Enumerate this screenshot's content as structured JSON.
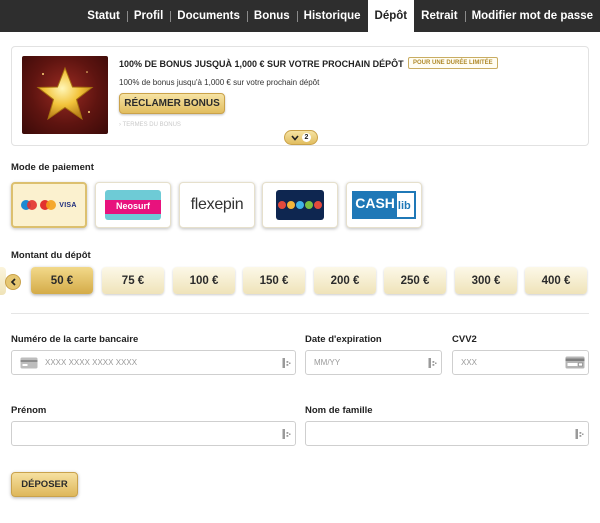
{
  "nav": {
    "items": [
      {
        "label": "Statut"
      },
      {
        "label": "Profil"
      },
      {
        "label": "Documents"
      },
      {
        "label": "Bonus"
      },
      {
        "label": "Historique"
      },
      {
        "label": "Dépôt",
        "active": true
      },
      {
        "label": "Retrait"
      },
      {
        "label": "Modifier mot de passe"
      }
    ]
  },
  "bonus": {
    "title": "100% DE BONUS JUSQUÀ 1,000 € SUR VOTRE PROCHAIN DÉPÔT",
    "badge": "POUR UNE DURÉE LIMITÉE",
    "subtitle": "100% de bonus jusqu'à 1,000 € sur votre prochain dépôt",
    "claim_label": "RÉCLAMER BONUS",
    "terms_label": "TERMES DU BONUS",
    "more_count": "2",
    "image_icon": "gold-star"
  },
  "payment": {
    "label": "Mode de paiement",
    "methods": [
      {
        "name": "cards",
        "brands": [
          "Maestro",
          "Mastercard"
        ],
        "visa_text": "VISA",
        "selected": true
      },
      {
        "name": "neosurf",
        "logo_text": "Neosurf"
      },
      {
        "name": "flexepin",
        "logo_text": "flexepin"
      },
      {
        "name": "voucher",
        "logo_text": ""
      },
      {
        "name": "cashlib",
        "logo_cash": "CASH",
        "logo_lib": "lib"
      }
    ]
  },
  "amount": {
    "label": "Montant du dépôt",
    "options": [
      "50 €",
      "75 €",
      "100 €",
      "150 €",
      "200 €",
      "250 €",
      "300 €",
      "400 €"
    ],
    "selected_index": 0
  },
  "form": {
    "card_number_label": "Numéro de la carte bancaire",
    "card_number_placeholder": "XXXX XXXX XXXX XXXX",
    "expiry_label": "Date d'expiration",
    "expiry_placeholder": "MM/YY",
    "cvv_label": "CVV2",
    "cvv_placeholder": "XXX",
    "firstname_label": "Prénom",
    "firstname_value": "",
    "lastname_label": "Nom de famille",
    "lastname_value": ""
  },
  "deposit_label": "DÉPOSER",
  "colors": {
    "nav_bg": "#2e2e2e",
    "gold": "#e1bd5f",
    "gold_light": "#f6e3a4",
    "selected_bg": "#fbf1cf"
  }
}
